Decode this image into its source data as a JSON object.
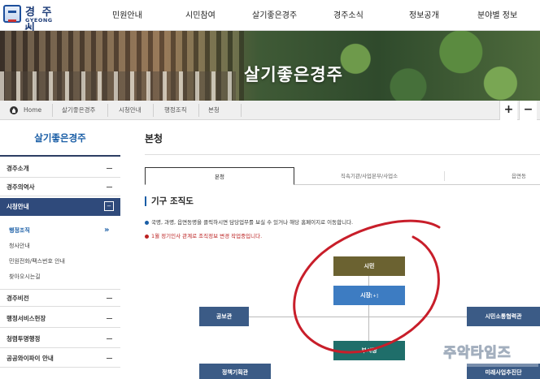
{
  "logo": {
    "korean": "경 주 시",
    "english": "GYEONG JU"
  },
  "nav": [
    "민원안내",
    "시민참여",
    "살기좋은경주",
    "경주소식",
    "정보공개",
    "분야별 정보"
  ],
  "hero": {
    "title": "살기좋은경주"
  },
  "breadcrumb": {
    "home": "Home",
    "items": [
      "살기좋은경주",
      "시청안내",
      "행정조직",
      "본청"
    ],
    "plus": "+",
    "minus": "−"
  },
  "sidebar": {
    "title": "살기좋은경주",
    "items_top": [
      "경주소개",
      "경주의역사"
    ],
    "active": {
      "label": "시청안내",
      "toggle": "−"
    },
    "sub_items": [
      "행정조직",
      "청사안내",
      "민원전화/팩스번호 안내",
      "찾아오시는길"
    ],
    "sub_arrow": "»",
    "items_bottom": [
      "경주비전",
      "행정서비스헌장",
      "청렴투명행정",
      "공공와이파이 안내"
    ]
  },
  "main": {
    "page_title": "본청",
    "tabs": [
      "본청",
      "직속기관/사업본부/사업소",
      "읍면동"
    ],
    "section_title": "기구 조직도",
    "notes": [
      "국명, 과명, 읍면동명을 클릭하시면 담당업무를 보실 수 있거나 해당 홈페이지로 이동합니다.",
      "1월 정기인사 관계로 조직정보 변경 작업중입니다."
    ]
  },
  "org": {
    "citizen": "시민",
    "mayor": "시장",
    "mayor_badge": "[+]",
    "deputy_mayor": "부시장",
    "pr_office": "공보관",
    "planning_office": "정책기획관",
    "citizen_comm_office": "시민소통협력관",
    "future_office": "미래사업추진단"
  },
  "colors": {
    "olive": "#6b6231",
    "mayor_blue": "#3d7cc2",
    "navy": "#3b5b86",
    "teal": "#1f6e6a",
    "accent": "#1a5ea6",
    "red_note": "#b22222"
  },
  "watermark": "주악타임즈"
}
